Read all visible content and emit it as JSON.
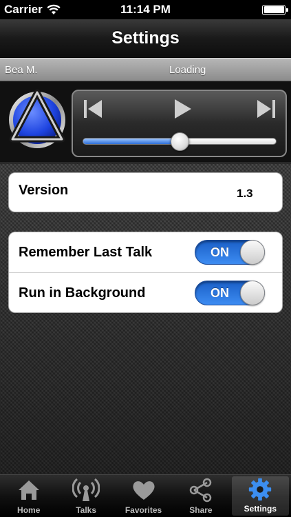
{
  "status_bar": {
    "carrier": "Carrier",
    "time": "11:14 PM"
  },
  "nav": {
    "title": "Settings"
  },
  "info_bar": {
    "speaker": "Bea M.",
    "status": "Loading"
  },
  "player": {
    "progress": 0.5,
    "logo_icon": "aa-triangle-logo-icon",
    "controls": [
      "previous-icon",
      "play-icon",
      "next-icon"
    ]
  },
  "settings": {
    "version": {
      "label": "Version",
      "value": "1.3"
    },
    "toggles": [
      {
        "label": "Remember Last Talk",
        "state": "ON"
      },
      {
        "label": "Run in Background",
        "state": "ON"
      }
    ]
  },
  "tabs": [
    {
      "label": "Home",
      "icon": "house-icon",
      "active": false
    },
    {
      "label": "Talks",
      "icon": "broadcast-icon",
      "active": false
    },
    {
      "label": "Favorites",
      "icon": "heart-icon",
      "active": false
    },
    {
      "label": "Share",
      "icon": "share-icon",
      "active": false
    },
    {
      "label": "Settings",
      "icon": "gear-icon",
      "active": true
    }
  ],
  "colors": {
    "accent_blue": "#2f6fd8",
    "switch_on": "#3d8cf2",
    "logo_blue": "#1e44e0"
  }
}
